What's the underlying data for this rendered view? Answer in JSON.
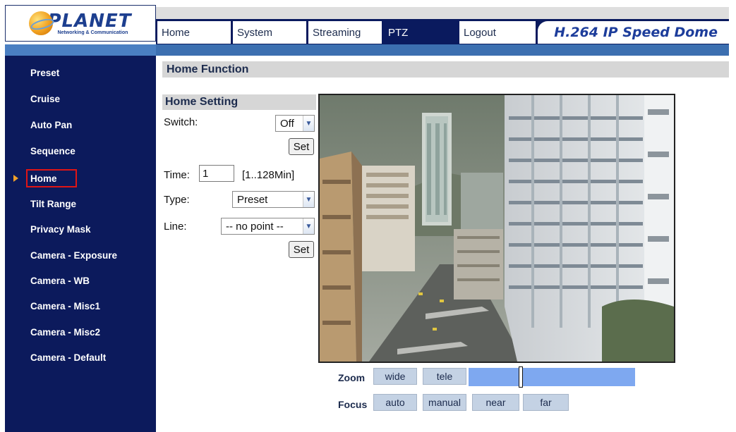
{
  "header": {
    "logo_word": "PLANET",
    "logo_sub": "Networking & Communication",
    "brand": "H.264 IP Speed Dome",
    "tabs": [
      {
        "label": "Home"
      },
      {
        "label": "System"
      },
      {
        "label": "Streaming"
      },
      {
        "label": "PTZ"
      },
      {
        "label": "Logout"
      }
    ],
    "active_tab": "PTZ"
  },
  "sidebar": {
    "items": [
      {
        "label": "Preset"
      },
      {
        "label": "Cruise"
      },
      {
        "label": "Auto Pan"
      },
      {
        "label": "Sequence"
      },
      {
        "label": "Home"
      },
      {
        "label": "Tilt Range"
      },
      {
        "label": "Privacy Mask"
      },
      {
        "label": "Camera - Exposure"
      },
      {
        "label": "Camera - WB"
      },
      {
        "label": "Camera - Misc1"
      },
      {
        "label": "Camera - Misc2"
      },
      {
        "label": "Camera - Default"
      }
    ],
    "current": "Home"
  },
  "main": {
    "title": "Home Function",
    "setting_title": "Home Setting",
    "switch_label": "Switch:",
    "switch_value": "Off",
    "set_label": "Set",
    "time_label": "Time:",
    "time_value": "1",
    "time_range": "[1..128Min]",
    "type_label": "Type:",
    "type_value": "Preset",
    "line_label": "Line:",
    "line_value": "-- no point --"
  },
  "ptz": {
    "zoom_label": "Zoom",
    "wide": "wide",
    "tele": "tele",
    "focus_label": "Focus",
    "auto": "auto",
    "manual": "manual",
    "near": "near",
    "far": "far"
  },
  "colors": {
    "nav_bg": "#0a1a5e",
    "sidebar_bg": "#0c1a5c",
    "accent_blue": "#3c6fb0",
    "highlight_red": "#e01515",
    "button_bg": "#c4d2e4",
    "zoom_bar": "#7ea8f0"
  },
  "icons": {
    "side_arrow": "triangle-right-icon",
    "select_arrow": "chevron-down-icon"
  }
}
